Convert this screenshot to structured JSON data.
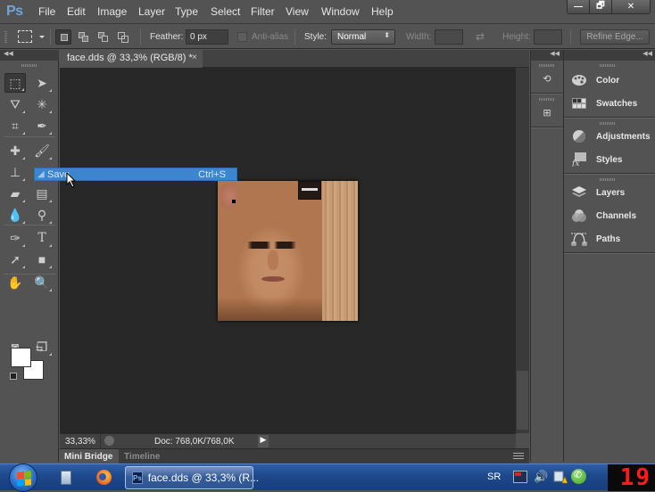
{
  "app": {
    "name": "Photoshop",
    "logo": "Ps"
  },
  "menubar": {
    "items": [
      "File",
      "Edit",
      "Image",
      "Layer",
      "Type",
      "Select",
      "Filter",
      "View",
      "Window",
      "Help"
    ],
    "window_controls": {
      "minimize": "—",
      "restore": "🗗",
      "close": "✕"
    }
  },
  "options_bar": {
    "tool": "rectangular-marquee",
    "selection_modes": [
      "new-selection",
      "add-to-selection",
      "subtract-from-selection",
      "intersect-with-selection"
    ],
    "active_mode": "new-selection",
    "feather_label": "Feather:",
    "feather_value": "0 px",
    "antialias_label": "Anti-alias",
    "antialias_checked": false,
    "style_label": "Style:",
    "style_value": "Normal",
    "width_label": "Width:",
    "width_value": "",
    "height_label": "Height:",
    "height_value": "",
    "refine_edge_label": "Refine Edge..."
  },
  "document": {
    "tab_title": "face.dds @ 33,3% (RGB/8) *",
    "tab_close": "×",
    "zoom": "33,33%",
    "doc_size": "Doc: 768,0K/768,0K"
  },
  "context_menu": {
    "highlighted_item": {
      "label": "Save",
      "shortcut": "Ctrl+S"
    }
  },
  "tools": [
    {
      "name": "rectangular-marquee",
      "glyph": "⬚",
      "active": true
    },
    {
      "name": "move",
      "glyph": "➤"
    },
    {
      "name": "polygonal-lasso",
      "glyph": "⛛"
    },
    {
      "name": "magic-wand",
      "glyph": "✳"
    },
    {
      "name": "crop",
      "glyph": "⌗"
    },
    {
      "name": "eyedropper",
      "glyph": "✒"
    },
    {
      "name": "spot-healing",
      "glyph": "✚"
    },
    {
      "name": "brush",
      "glyph": "🖌"
    },
    {
      "name": "clone-stamp",
      "glyph": "⊥"
    },
    {
      "name": "history-brush",
      "glyph": "✎"
    },
    {
      "name": "eraser",
      "glyph": "▰"
    },
    {
      "name": "gradient",
      "glyph": "▤"
    },
    {
      "name": "blur",
      "glyph": "💧"
    },
    {
      "name": "dodge",
      "glyph": "⚲"
    },
    {
      "name": "pen",
      "glyph": "✑"
    },
    {
      "name": "type",
      "glyph": "T"
    },
    {
      "name": "path-selection",
      "glyph": "➚"
    },
    {
      "name": "rectangle-shape",
      "glyph": "■"
    },
    {
      "name": "hand",
      "glyph": "✋"
    },
    {
      "name": "zoom",
      "glyph": "🔍"
    },
    {
      "name": "quick-mask",
      "glyph": "◙"
    },
    {
      "name": "screen-mode",
      "glyph": "❐"
    }
  ],
  "colors": {
    "foreground": "#ffffff",
    "background": "#ffffff",
    "accent": "#3c86d0"
  },
  "panel_strip": [
    {
      "name": "history",
      "glyph": "⟲"
    },
    {
      "name": "properties",
      "glyph": "⊞"
    }
  ],
  "panels": {
    "group1": [
      {
        "label": "Color",
        "icon": "palette-icon"
      },
      {
        "label": "Swatches",
        "icon": "swatches-icon"
      }
    ],
    "group2": [
      {
        "label": "Adjustments",
        "icon": "adjustments-icon"
      },
      {
        "label": "Styles",
        "icon": "styles-icon"
      }
    ],
    "group3": [
      {
        "label": "Layers",
        "icon": "layers-icon"
      },
      {
        "label": "Channels",
        "icon": "channels-icon"
      },
      {
        "label": "Paths",
        "icon": "paths-icon"
      }
    ]
  },
  "bottom_tabs": {
    "mini_bridge": "Mini Bridge",
    "timeline": "Timeline"
  },
  "taskbar": {
    "active_task": "face.dds @ 33,3% (R...",
    "task_icon": "Ps",
    "language": "SR",
    "clock": "19"
  }
}
